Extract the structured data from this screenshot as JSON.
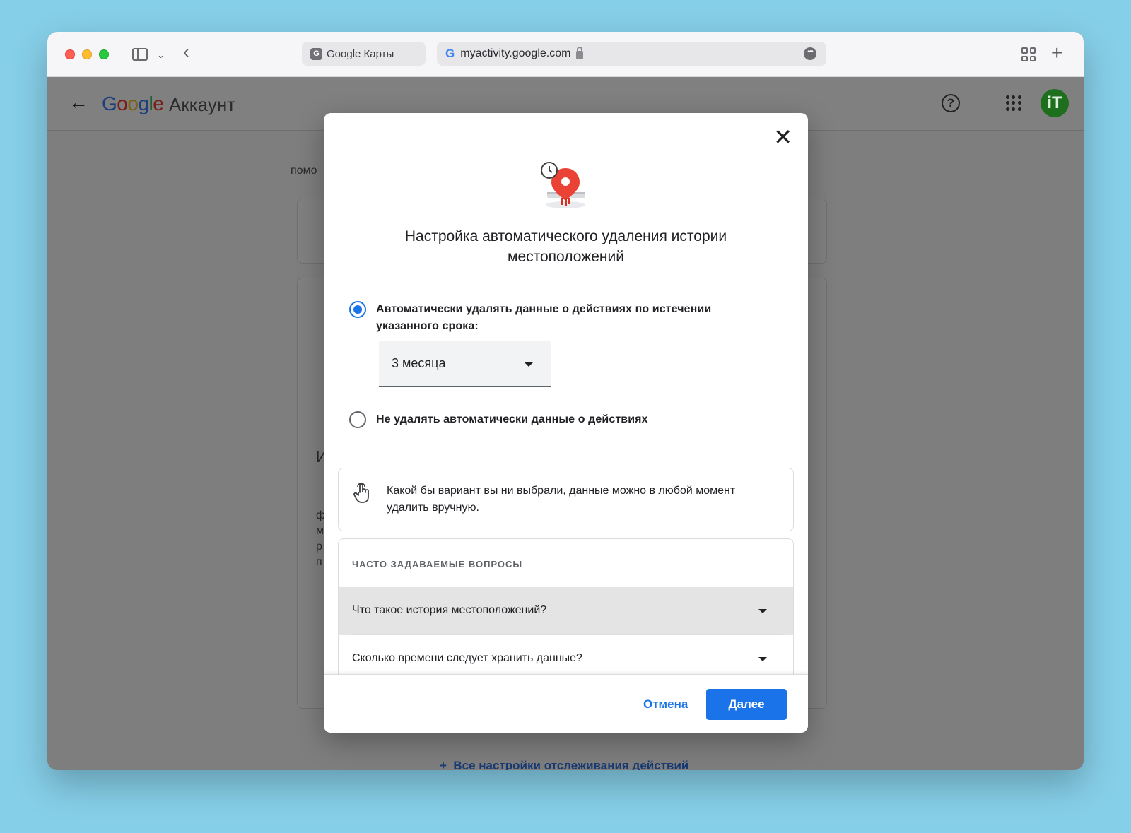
{
  "browser": {
    "tab_inactive_label": "Google Карты",
    "tab_inactive_favicon": "G",
    "address_url": "myactivity.google.com",
    "address_favicon": "G",
    "traffic_lights": {
      "close": "#fe5f57",
      "minimize": "#febc2e",
      "zoom": "#28c840"
    }
  },
  "appbar": {
    "logo": {
      "G": "G",
      "o1": "o",
      "o2": "o",
      "g": "g",
      "l": "l",
      "e": "e"
    },
    "product_label": "Аккаунт",
    "avatar_text": "iT"
  },
  "background_page": {
    "partial_text_top": "помо",
    "partial_letter_1": "И",
    "partial_letters_col": [
      "ф",
      "м",
      "р",
      "п"
    ],
    "bottom_link": "Все настройки отслеживания действий"
  },
  "dialog": {
    "title": "Настройка автоматического удаления истории местоположений",
    "option_auto": "Автоматически удалять данные о действиях по истечении указанного срока:",
    "option_auto_selected": true,
    "period_select_value": "3 месяца",
    "option_manual": "Не удалять автоматически данные о действиях",
    "option_manual_selected": false,
    "info_text": "Какой бы вариант вы ни выбрали, данные можно в любой момент удалить вручную.",
    "faq_heading": "ЧАСТО ЗАДАВАЕМЫЕ ВОПРОСЫ",
    "faq_items": [
      "Что такое история местоположений?",
      "Сколько времени следует хранить данные?"
    ],
    "cancel_label": "Отмена",
    "next_label": "Далее"
  },
  "colors": {
    "accent": "#1a73e8",
    "background": "#86cfe8",
    "overlay_page": "#7e7e7e"
  }
}
